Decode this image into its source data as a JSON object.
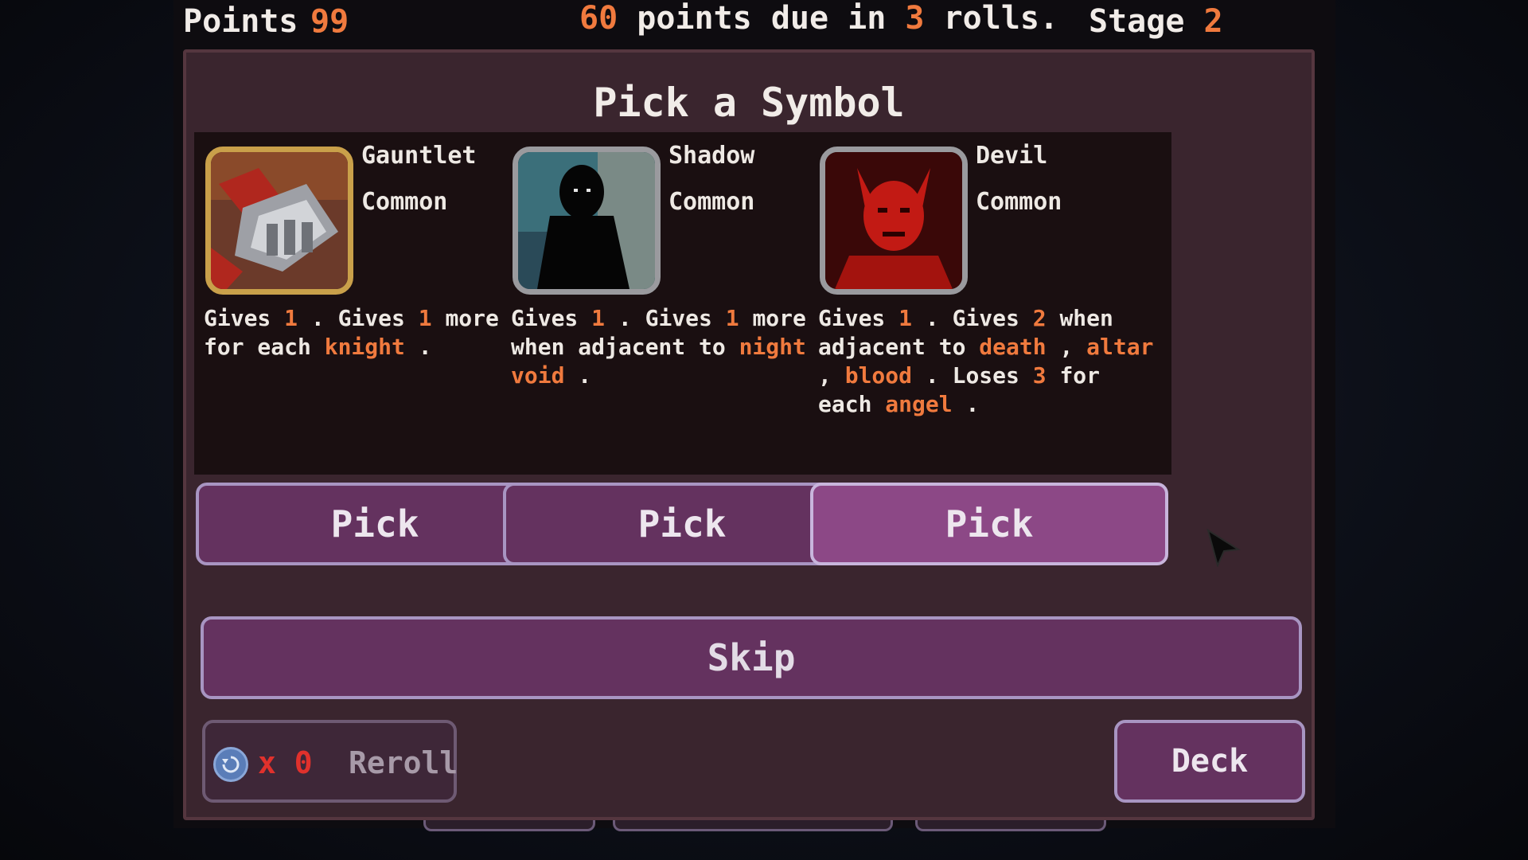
{
  "topbar": {
    "points_label": "Points",
    "points_value": "99",
    "due_amount": "60",
    "due_text_mid": " points due in ",
    "due_rolls": "3",
    "due_text_end": " rolls.",
    "stage_label": "Stage ",
    "stage_value": "2"
  },
  "panel": {
    "title": "Pick a Symbol"
  },
  "cards": [
    {
      "name": "Gauntlet",
      "rarity": "Common",
      "icon": "gauntlet-icon",
      "desc": [
        {
          "t": "Gives ",
          "h": false
        },
        {
          "t": "1",
          "h": true
        },
        {
          "t": " . Gives ",
          "h": false
        },
        {
          "t": "1",
          "h": true
        },
        {
          "t": " more for each ",
          "h": false
        },
        {
          "t": "knight",
          "h": true
        },
        {
          "t": " .",
          "h": false
        }
      ]
    },
    {
      "name": "Shadow",
      "rarity": "Common",
      "icon": "shadow-icon",
      "desc": [
        {
          "t": "Gives ",
          "h": false
        },
        {
          "t": "1",
          "h": true
        },
        {
          "t": " . Gives ",
          "h": false
        },
        {
          "t": "1",
          "h": true
        },
        {
          "t": " more when adjacent to ",
          "h": false
        },
        {
          "t": "night",
          "h": true
        },
        {
          "t": " , ",
          "h": false
        },
        {
          "t": "void",
          "h": true
        },
        {
          "t": " .",
          "h": false
        }
      ]
    },
    {
      "name": "Devil",
      "rarity": "Common",
      "icon": "devil-icon",
      "desc": [
        {
          "t": "Gives ",
          "h": false
        },
        {
          "t": "1",
          "h": true
        },
        {
          "t": " . Gives ",
          "h": false
        },
        {
          "t": "2",
          "h": true
        },
        {
          "t": " when adjacent to ",
          "h": false
        },
        {
          "t": "death",
          "h": true
        },
        {
          "t": " , ",
          "h": false
        },
        {
          "t": "altar",
          "h": true
        },
        {
          "t": " , ",
          "h": false
        },
        {
          "t": "blood",
          "h": true
        },
        {
          "t": " . Loses ",
          "h": false
        },
        {
          "t": "3",
          "h": true
        },
        {
          "t": " for each ",
          "h": false
        },
        {
          "t": "angel",
          "h": true
        },
        {
          "t": " .",
          "h": false
        }
      ]
    }
  ],
  "buttons": {
    "pick_label": "Pick",
    "skip_label": "Skip",
    "reroll_count": "x 0",
    "reroll_label": "Reroll",
    "deck_label": "Deck"
  },
  "colors": {
    "accent": "#f07a3e",
    "panel": "#3a252e",
    "button": "#64325f",
    "button_hover": "#8c4886",
    "button_border": "#a895c2"
  }
}
